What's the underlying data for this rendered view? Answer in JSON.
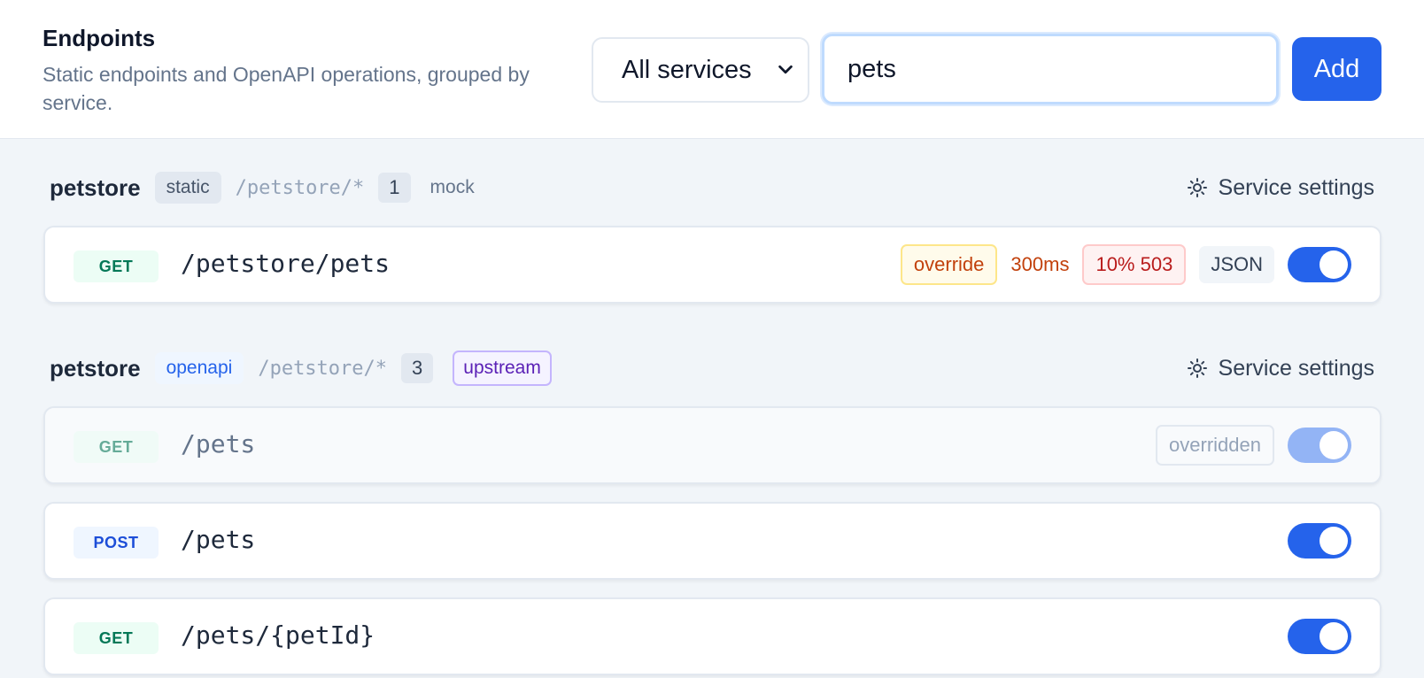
{
  "header": {
    "title": "Endpoints",
    "subtitle": "Static endpoints and OpenAPI operations, grouped by service.",
    "service_filter": {
      "selected": "All services"
    },
    "search": {
      "value": "pets"
    },
    "add_label": "Add"
  },
  "groups": [
    {
      "service": "petstore",
      "source": "static",
      "path_pattern": "/petstore/*",
      "count": "1",
      "mode": "mock",
      "settings_label": "Service settings",
      "endpoints": [
        {
          "method": "GET",
          "path": "/petstore/pets",
          "override": "override",
          "latency": "300ms",
          "error": "10% 503",
          "format": "JSON",
          "enabled": true
        }
      ]
    },
    {
      "service": "petstore",
      "source": "openapi",
      "path_pattern": "/petstore/*",
      "count": "3",
      "mode": "upstream",
      "settings_label": "Service settings",
      "endpoints": [
        {
          "method": "GET",
          "path": "/pets",
          "status": "overridden",
          "enabled": true,
          "dimmed": true
        },
        {
          "method": "POST",
          "path": "/pets",
          "enabled": true
        },
        {
          "method": "GET",
          "path": "/pets/{petId}",
          "enabled": true
        }
      ]
    }
  ],
  "colors": {
    "accent": "#2563eb",
    "get": "#047857",
    "post": "#1d4ed8",
    "warning": "#c2410c",
    "error": "#b91c1c",
    "upstream": "#5b21b6"
  },
  "icons": {
    "settings": "gear-icon",
    "select": "chevron-down-icon"
  }
}
